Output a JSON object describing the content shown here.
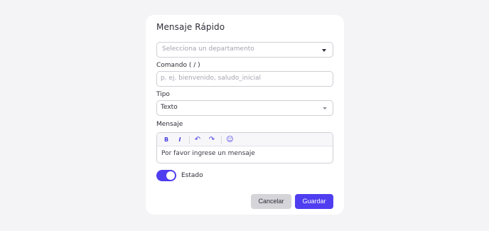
{
  "modal": {
    "title": "Mensaje Rápido"
  },
  "department_select": {
    "placeholder": "Selecciona un departamento",
    "icon": "chevron-down-icon"
  },
  "command_field": {
    "label": "Comando ( / )",
    "placeholder": "p. ej. bienvenido, saludo_inicial"
  },
  "type_field": {
    "label": "Tipo",
    "value": "Texto",
    "icon": "chevron-down-icon"
  },
  "message_field": {
    "label": "Mensaje",
    "toolbar": {
      "bold": "B",
      "italic": "I",
      "undo": "↶",
      "redo": "↷",
      "emoji": "☺"
    },
    "body": "Por favor ingrese un mensaje"
  },
  "status_toggle": {
    "label": "Estado",
    "on": true,
    "accent": "#4f3ef0"
  },
  "actions": {
    "cancel_label": "Cancelar",
    "save_label": "Guardar"
  },
  "colors": {
    "background": "#f4f4f6",
    "primary": "#4f3ef0",
    "cancel_bg": "#d4d4d9"
  }
}
